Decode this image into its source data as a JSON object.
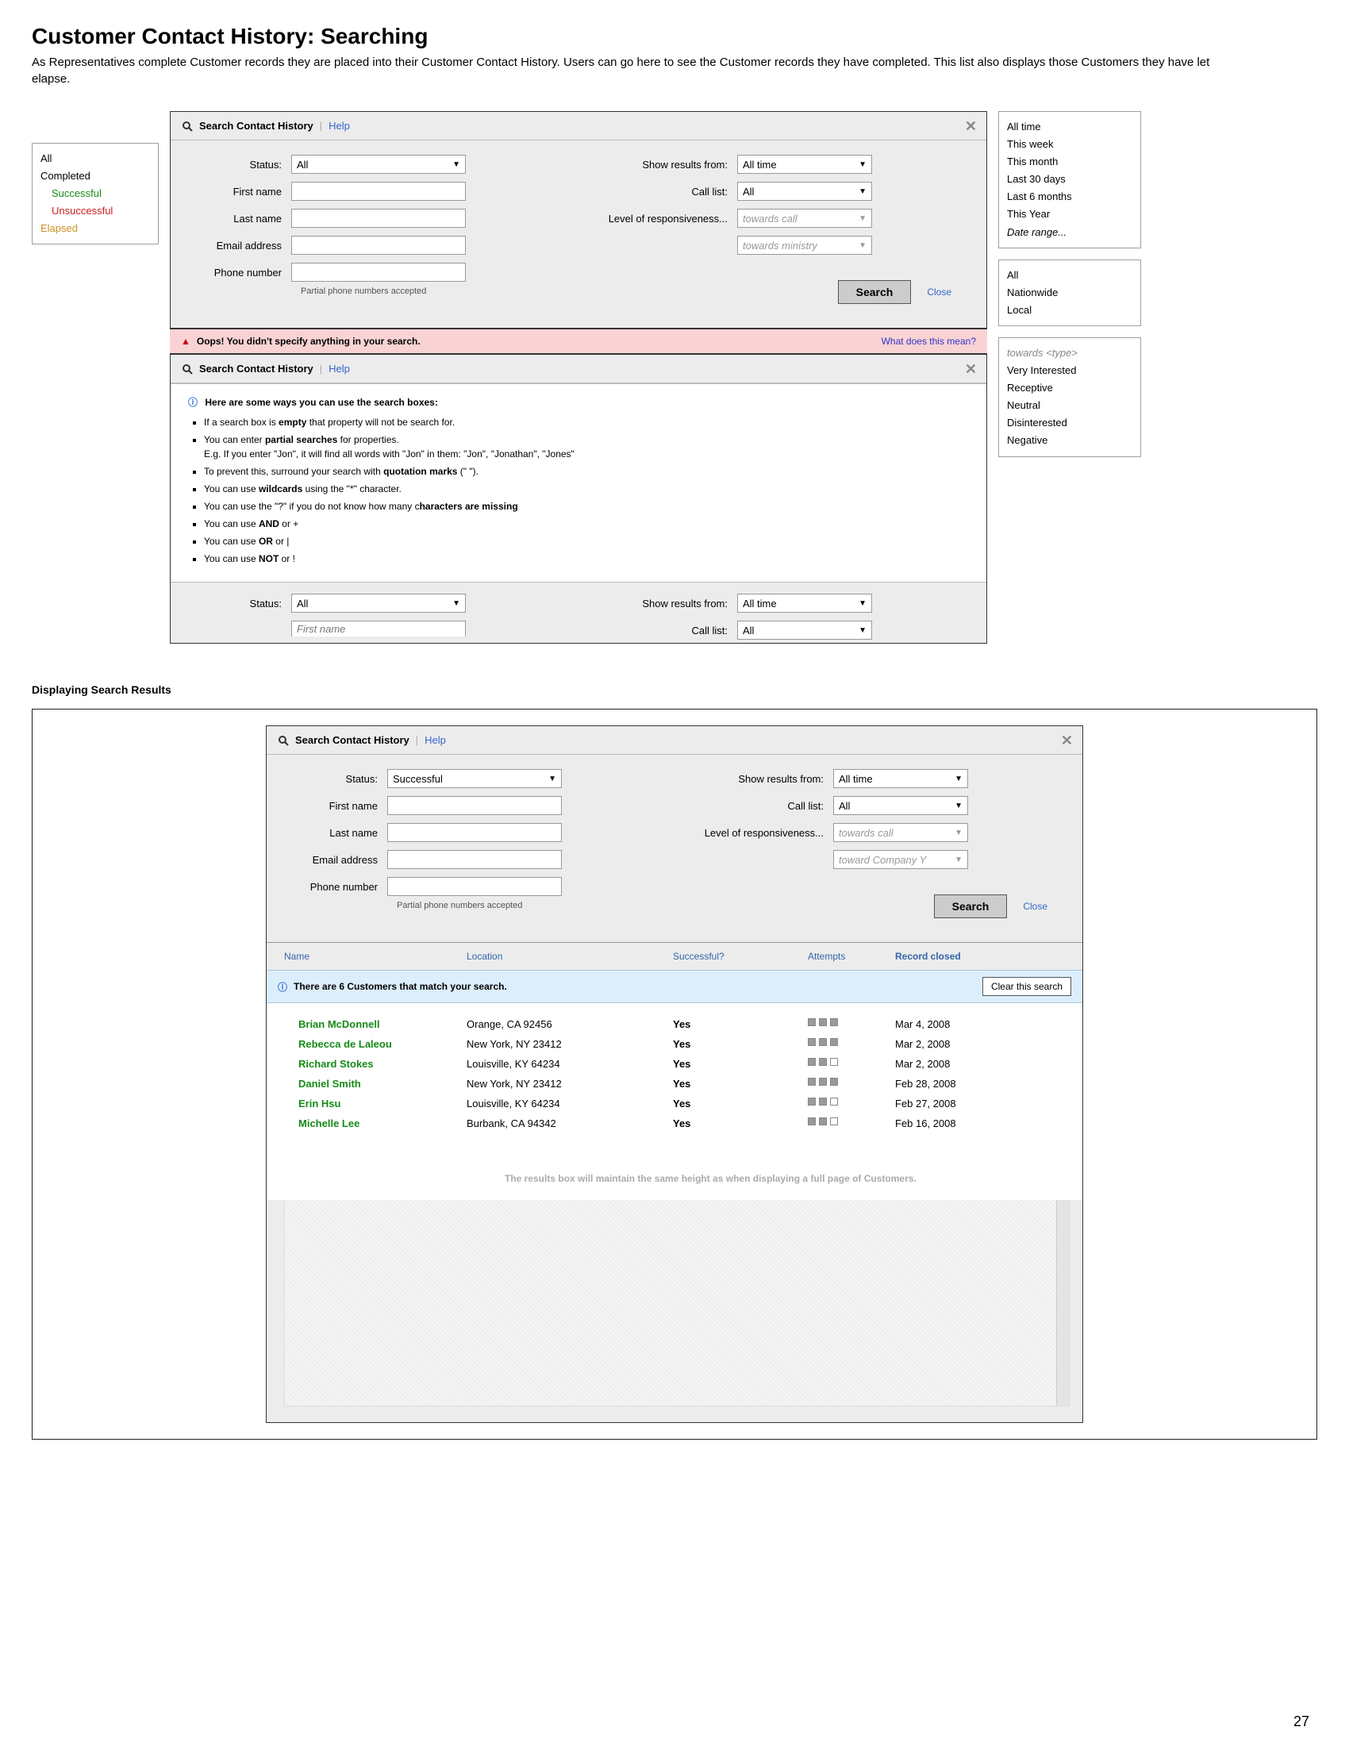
{
  "page": {
    "title": "Customer Contact History: Searching",
    "intro": "As Representatives complete Customer records they are placed into their Customer Contact History. Users can go here to see the Customer records they have completed. This list also displays those Customers they have let elapse.",
    "number": "27"
  },
  "popups": {
    "status": {
      "all": "All",
      "completed": "Completed",
      "successful": "Successful",
      "unsuccessful": "Unsuccessful",
      "elapsed": "Elapsed"
    },
    "time": {
      "all": "All time",
      "week": "This week",
      "month": "This month",
      "last30": "Last 30 days",
      "last6": "Last 6 months",
      "year": "This Year",
      "range": "Date range..."
    },
    "calllist": {
      "all": "All",
      "nationwide": "Nationwide",
      "local": "Local"
    },
    "resp": {
      "hdr": "towards <type>",
      "vi": "Very Interested",
      "rec": "Receptive",
      "neu": "Neutral",
      "dis": "Disinterested",
      "neg": "Negative"
    }
  },
  "panel": {
    "title": "Search Contact History",
    "sep": "|",
    "help": "Help",
    "close_x": "✕",
    "labels": {
      "status": "Status:",
      "firstname": "First name",
      "lastname": "Last name",
      "email": "Email address",
      "phone": "Phone number",
      "partial": "Partial phone numbers accepted",
      "showfrom": "Show results from:",
      "calllist": "Call list:",
      "responsiveness": "Level of responsiveness..."
    },
    "values": {
      "status_all": "All",
      "time_all": "All time",
      "calllist_all": "All",
      "towards_call": "towards call",
      "towards_ministry": "towards ministry"
    },
    "search_btn": "Search",
    "close_link": "Close"
  },
  "error": {
    "icon": "▲",
    "text": "Oops! You didn't specify anything in your search.",
    "link": "What does this mean?"
  },
  "help_panel": {
    "info_icon": "ⓘ",
    "lead": "Here are some ways you can use the search boxes:",
    "items": {
      "empty_a": "If a search box is ",
      "empty_b": "empty",
      "empty_c": " that property will not be search for.",
      "partial_a": "You can enter ",
      "partial_b": "partial searches",
      "partial_c": " for properties.",
      "eg": "E.g. If you enter \"Jon\", it will find all words with \"Jon\" in them: \"Jon\", \"Jonathan\", \"Jones\"",
      "quotes_a": "To prevent this, surround your search with ",
      "quotes_b": "quotation marks",
      "quotes_c": " (\" \").",
      "wild_a": "You can use ",
      "wild_b": "wildcards",
      "wild_c": " using the \"*\" character.",
      "quest_a": "You can use the \"?\" if you do not know how many c",
      "quest_b": "haracters are missing",
      "and_a": "You can use ",
      "and_b": "AND",
      "and_c": " or +",
      "or_a": "You can use ",
      "or_b": "OR",
      "or_c": " or |",
      "not_a": "You can use ",
      "not_b": "NOT",
      "not_c": " or !"
    },
    "subform": {
      "status": "All",
      "firstname_ph": "First name",
      "time": "All time",
      "calllist": "All"
    }
  },
  "results_section": {
    "heading": "Displaying Search Results",
    "status_value": "Successful",
    "towards_company": "toward Company Y",
    "columns": {
      "name": "Name",
      "location": "Location",
      "successful": "Successful?",
      "attempts": "Attempts",
      "closed": "Record closed"
    },
    "info_bar": {
      "text": "There are 6 Customers that match your search.",
      "clear": "Clear this search"
    },
    "rows": [
      {
        "name": "Brian McDonnell",
        "loc": "Orange, CA 92456",
        "yes": "Yes",
        "att": 3,
        "date": "Mar 4, 2008"
      },
      {
        "name": "Rebecca de Laleou",
        "loc": "New York, NY 23412",
        "yes": "Yes",
        "att": 3,
        "date": "Mar 2, 2008"
      },
      {
        "name": "Richard Stokes",
        "loc": "Louisville, KY 64234",
        "yes": "Yes",
        "att": 2,
        "date": "Mar 2, 2008"
      },
      {
        "name": "Daniel Smith",
        "loc": "New York, NY 23412",
        "yes": "Yes",
        "att": 3,
        "date": "Feb 28, 2008"
      },
      {
        "name": "Erin Hsu",
        "loc": "Louisville, KY 64234",
        "yes": "Yes",
        "att": 2,
        "date": "Feb 27, 2008"
      },
      {
        "name": "Michelle Lee",
        "loc": "Burbank, CA 94342",
        "yes": "Yes",
        "att": 2,
        "date": "Feb 16, 2008"
      }
    ],
    "ghost_note": "The results box will maintain the same height as when displaying a full page of Customers."
  }
}
